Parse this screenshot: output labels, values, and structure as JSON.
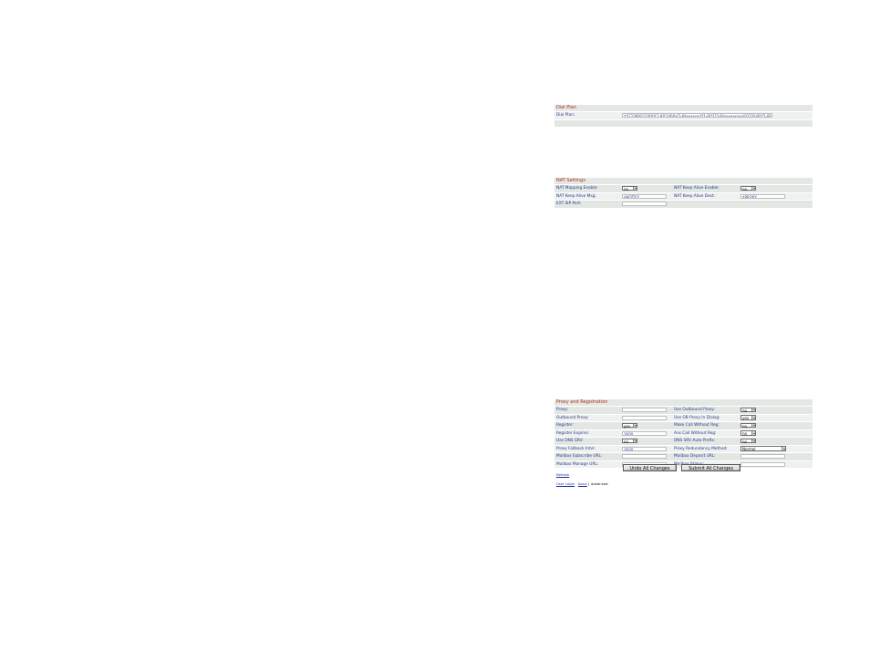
{
  "dial_plan": {
    "title": "Dial Plan",
    "label": "Dial Plan:",
    "value": "(*1[2369]|1100|*[1-9]*1400x[2-9]xxxxxx|*[1-9]*1[2-9]xxxxxxxxx|011[0-9]*[2-9]x)"
  },
  "nat": {
    "title": "NAT Settings",
    "rows": [
      {
        "l1": "NAT Mapping Enable:",
        "v1": "no",
        "l2": "NAT Keep Alive Enable:",
        "v2": "no"
      },
      {
        "l1": "NAT Keep Alive Msg:",
        "v1": "$NOTIFY",
        "l2": "NAT Keep Alive Dest:",
        "v2": "$PROXY"
      },
      {
        "l1": "EXT SIP Port:",
        "v1": "",
        "l2": "",
        "v2": ""
      }
    ]
  },
  "proxy": {
    "title": "Proxy and Registration",
    "rows": [
      {
        "l1": "Proxy:",
        "v1": "",
        "l2": "Use Outbound Proxy:",
        "v2": "no"
      },
      {
        "l1": "Outbound Proxy:",
        "v1": "",
        "l2": "Use OB Proxy In Dialog:",
        "v2": "yes"
      },
      {
        "l1": "Register:",
        "v1": "yes",
        "l2": "Make Call Without Reg:",
        "v2": "no"
      },
      {
        "l1": "Register Expires:",
        "v1": "3600",
        "l2": "Ans Call Without Reg:",
        "v2": "no"
      },
      {
        "l1": "Use DNS SRV:",
        "v1": "no",
        "l2": "DNS SRV Auto Prefix:",
        "v2": "no"
      },
      {
        "l1": "Proxy Fallback Intvl:",
        "v1": "3600",
        "l2": "Proxy Redundancy Method:",
        "v2": "Normal"
      },
      {
        "l1": "Mailbox Subscribe URL:",
        "v1": "",
        "l2": "Mailbox Deposit URL:",
        "v2": ""
      },
      {
        "l1": "Mailbox Manage URL:",
        "v1": "",
        "l2": "Mailbox Status:",
        "v2": ""
      }
    ]
  },
  "buttons": {
    "undo": "Undo All Changes",
    "submit": "Submit All Changes"
  },
  "footer": {
    "refresh": "Refresh",
    "user_login": "User Login",
    "basic": "basic",
    "separator": "|",
    "advanced": "advanced"
  }
}
